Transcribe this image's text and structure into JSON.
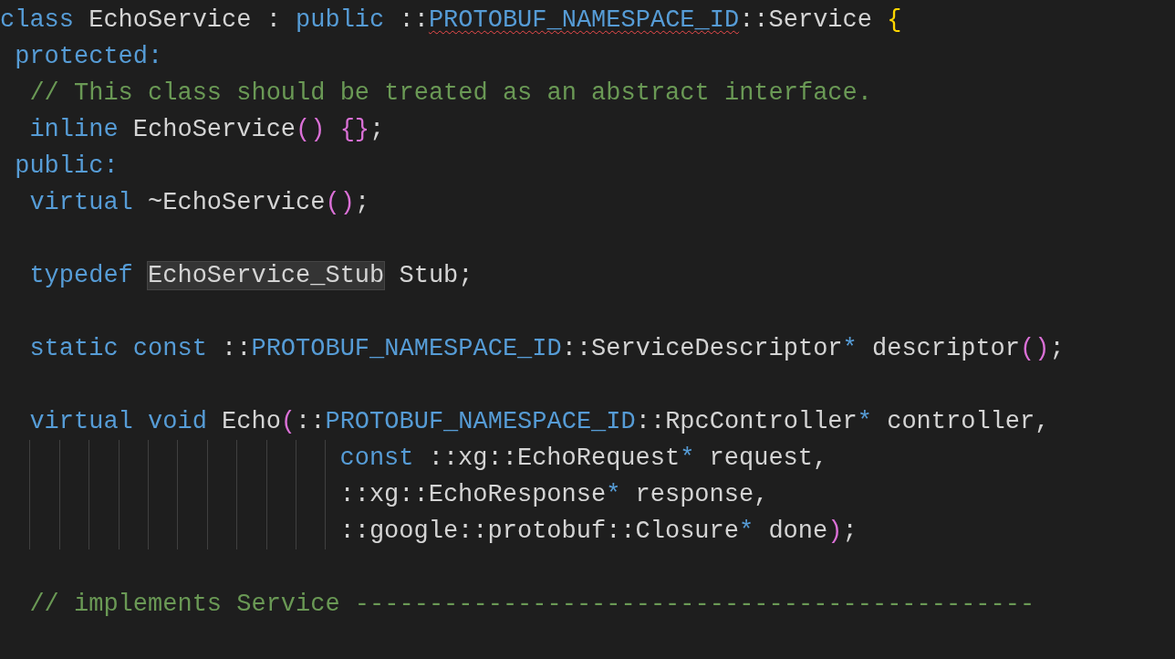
{
  "editor": {
    "lines": [
      {
        "kind": "code",
        "tokens": [
          {
            "text": "class",
            "kind": "keyword"
          },
          {
            "text": " EchoService : ",
            "kind": "text"
          },
          {
            "text": "public",
            "kind": "keyword"
          },
          {
            "text": " ::",
            "kind": "text"
          },
          {
            "text": "PROTOBUF_NAMESPACE_ID",
            "kind": "macro",
            "error": true
          },
          {
            "text": "::Service ",
            "kind": "text"
          },
          {
            "text": "{",
            "kind": "bracket1"
          }
        ]
      },
      {
        "kind": "code",
        "tokens": [
          {
            "text": " protected:",
            "kind": "keyword"
          }
        ]
      },
      {
        "kind": "code",
        "tokens": [
          {
            "text": "  // This class should be treated as an abstract interface.",
            "kind": "comment"
          }
        ]
      },
      {
        "kind": "code",
        "tokens": [
          {
            "text": "  inline",
            "kind": "keyword"
          },
          {
            "text": " EchoService",
            "kind": "text"
          },
          {
            "text": "() {}",
            "kind": "bracket2"
          },
          {
            "text": ";",
            "kind": "text"
          }
        ]
      },
      {
        "kind": "code",
        "tokens": [
          {
            "text": " public:",
            "kind": "keyword"
          }
        ]
      },
      {
        "kind": "code",
        "tokens": [
          {
            "text": "  virtual",
            "kind": "keyword"
          },
          {
            "text": " ~EchoService",
            "kind": "text"
          },
          {
            "text": "()",
            "kind": "bracket2"
          },
          {
            "text": ";",
            "kind": "text"
          }
        ]
      },
      {
        "kind": "blank"
      },
      {
        "kind": "code",
        "tokens": [
          {
            "text": "  typedef ",
            "kind": "keyword"
          },
          {
            "text": "EchoService_Stub",
            "kind": "text",
            "highlighted": true
          },
          {
            "text": " Stub;",
            "kind": "text"
          }
        ]
      },
      {
        "kind": "blank"
      },
      {
        "kind": "code",
        "tokens": [
          {
            "text": "  static const",
            "kind": "keyword"
          },
          {
            "text": " ::",
            "kind": "text"
          },
          {
            "text": "PROTOBUF_NAMESPACE_ID",
            "kind": "macro"
          },
          {
            "text": "::ServiceDescriptor",
            "kind": "text"
          },
          {
            "text": "*",
            "kind": "keyword"
          },
          {
            "text": " descriptor",
            "kind": "text"
          },
          {
            "text": "()",
            "kind": "bracket2"
          },
          {
            "text": ";",
            "kind": "text"
          }
        ]
      },
      {
        "kind": "blank"
      },
      {
        "kind": "code",
        "tokens": [
          {
            "text": "  virtual void",
            "kind": "keyword"
          },
          {
            "text": " Echo",
            "kind": "text"
          },
          {
            "text": "(",
            "kind": "bracket2"
          },
          {
            "text": "::",
            "kind": "text"
          },
          {
            "text": "PROTOBUF_NAMESPACE_ID",
            "kind": "macro"
          },
          {
            "text": "::RpcController",
            "kind": "text"
          },
          {
            "text": "*",
            "kind": "keyword"
          },
          {
            "text": " controller,",
            "kind": "text"
          }
        ]
      },
      {
        "kind": "continuation",
        "tokens": [
          {
            "text": "const",
            "kind": "keyword"
          },
          {
            "text": " ::xg::EchoRequest",
            "kind": "text"
          },
          {
            "text": "*",
            "kind": "keyword"
          },
          {
            "text": " request,",
            "kind": "text"
          }
        ]
      },
      {
        "kind": "continuation",
        "tokens": [
          {
            "text": "::xg::EchoResponse",
            "kind": "text"
          },
          {
            "text": "*",
            "kind": "keyword"
          },
          {
            "text": " response,",
            "kind": "text"
          }
        ]
      },
      {
        "kind": "continuation",
        "tokens": [
          {
            "text": "::google::protobuf::Closure",
            "kind": "text"
          },
          {
            "text": "*",
            "kind": "keyword"
          },
          {
            "text": " done",
            "kind": "text"
          },
          {
            "text": ")",
            "kind": "bracket2"
          },
          {
            "text": ";",
            "kind": "text"
          }
        ]
      },
      {
        "kind": "blank"
      },
      {
        "kind": "code",
        "tokens": [
          {
            "text": "  // implements Service ----------------------------------------------",
            "kind": "comment"
          }
        ]
      }
    ]
  }
}
